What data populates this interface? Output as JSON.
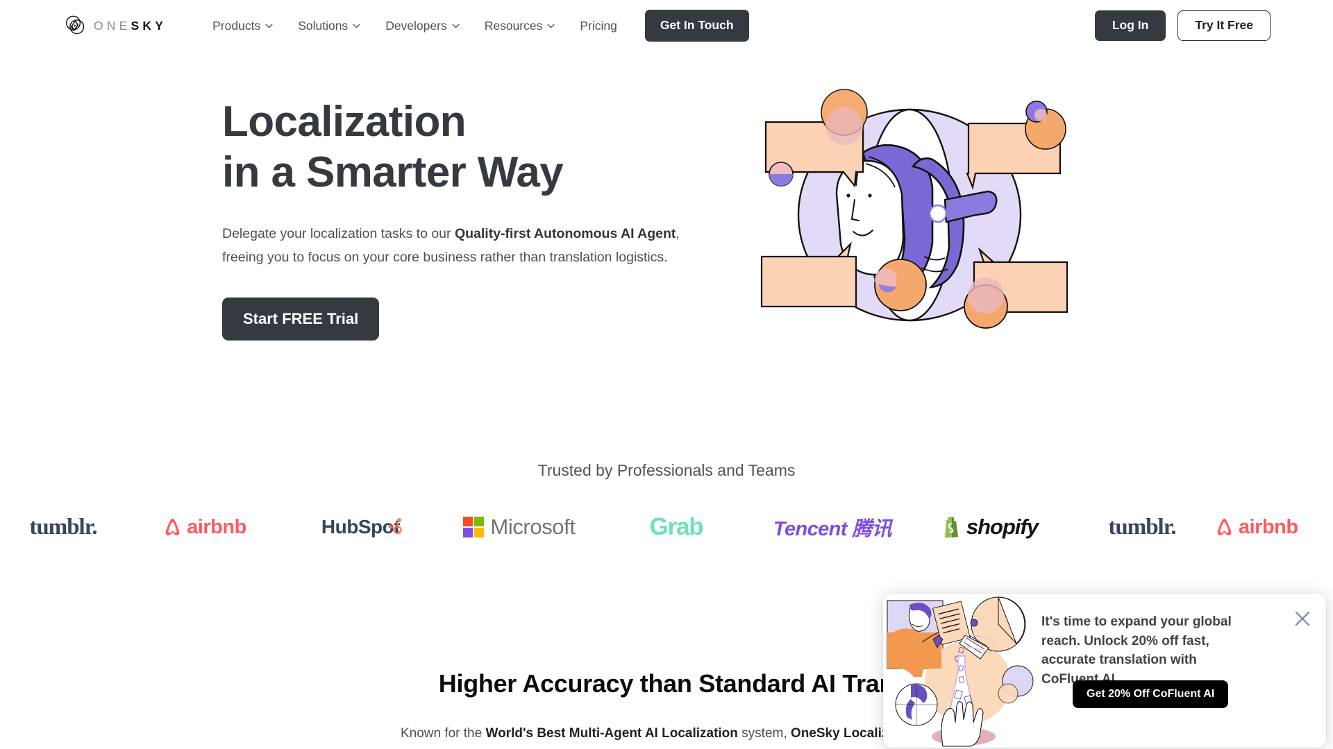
{
  "brand": {
    "name_light": "ONE",
    "name_bold": "SKY",
    "logo_icon": "onesky-compass-logo"
  },
  "header": {
    "nav": [
      {
        "label": "Products",
        "has_dropdown": true,
        "name": "products"
      },
      {
        "label": "Solutions",
        "has_dropdown": true,
        "name": "solutions"
      },
      {
        "label": "Developers",
        "has_dropdown": true,
        "name": "developers"
      },
      {
        "label": "Resources",
        "has_dropdown": true,
        "name": "resources"
      },
      {
        "label": "Pricing",
        "has_dropdown": false,
        "name": "pricing"
      }
    ],
    "get_in_touch": "Get In Touch",
    "log_in": "Log In",
    "try_it_free": "Try It Free"
  },
  "hero": {
    "title_line1": "Localization",
    "title_line2": "in a Smarter Way",
    "sub_part1": "Delegate your localization tasks to our ",
    "sub_bold": "Quality-first Autonomous AI Agent",
    "sub_part2": ", freeing you to focus on your core business rather than translation logistics.",
    "cta": "Start FREE Trial",
    "illustration": "person-with-speech-bubbles"
  },
  "trusted": {
    "title": "Trusted by Professionals and Teams",
    "logos": [
      {
        "name": "tumblr",
        "label": "tumblr.",
        "color": "#36465d"
      },
      {
        "name": "airbnb",
        "label": "airbnb",
        "color": "#ff5a5f"
      },
      {
        "name": "hubspot",
        "label": "HubSpot",
        "color": "#33475b"
      },
      {
        "name": "microsoft",
        "label": "Microsoft",
        "color": "#737373"
      },
      {
        "name": "grab",
        "label": "Grab",
        "color": "#6fe0bd"
      },
      {
        "name": "tencent",
        "label": "Tencent 腾讯",
        "color": "#7d4fe0"
      },
      {
        "name": "shopify",
        "label": "shopify",
        "color": "#151515"
      },
      {
        "name": "tumblr-2",
        "label": "tumblr.",
        "color": "#36465d"
      },
      {
        "name": "airbnb-2",
        "label": "airbnb",
        "color": "#ff5a5f"
      }
    ]
  },
  "section2": {
    "title": "Higher Accuracy than Standard AI Tran",
    "sub_part1": "Known for the ",
    "sub_bold1": "World's Best Multi-Agent AI Localization",
    "sub_part2": " system, ",
    "sub_bold2": "OneSky Localization A"
  },
  "promo": {
    "message": "It's time to expand your global reach. Unlock 20% off fast, accurate translation with CoFluent AI",
    "cta": "Get 20% Off CoFluent AI",
    "close_icon": "close-icon",
    "illustration": "cofluent-ai-lab-illustration"
  },
  "colors": {
    "dark": "#343a40",
    "black": "#000000",
    "purple": "#7b68d4",
    "lavender": "#ddd5f5",
    "peach": "#fcd5b4",
    "orange": "#f5a86b",
    "pink": "#f0bcc0"
  }
}
